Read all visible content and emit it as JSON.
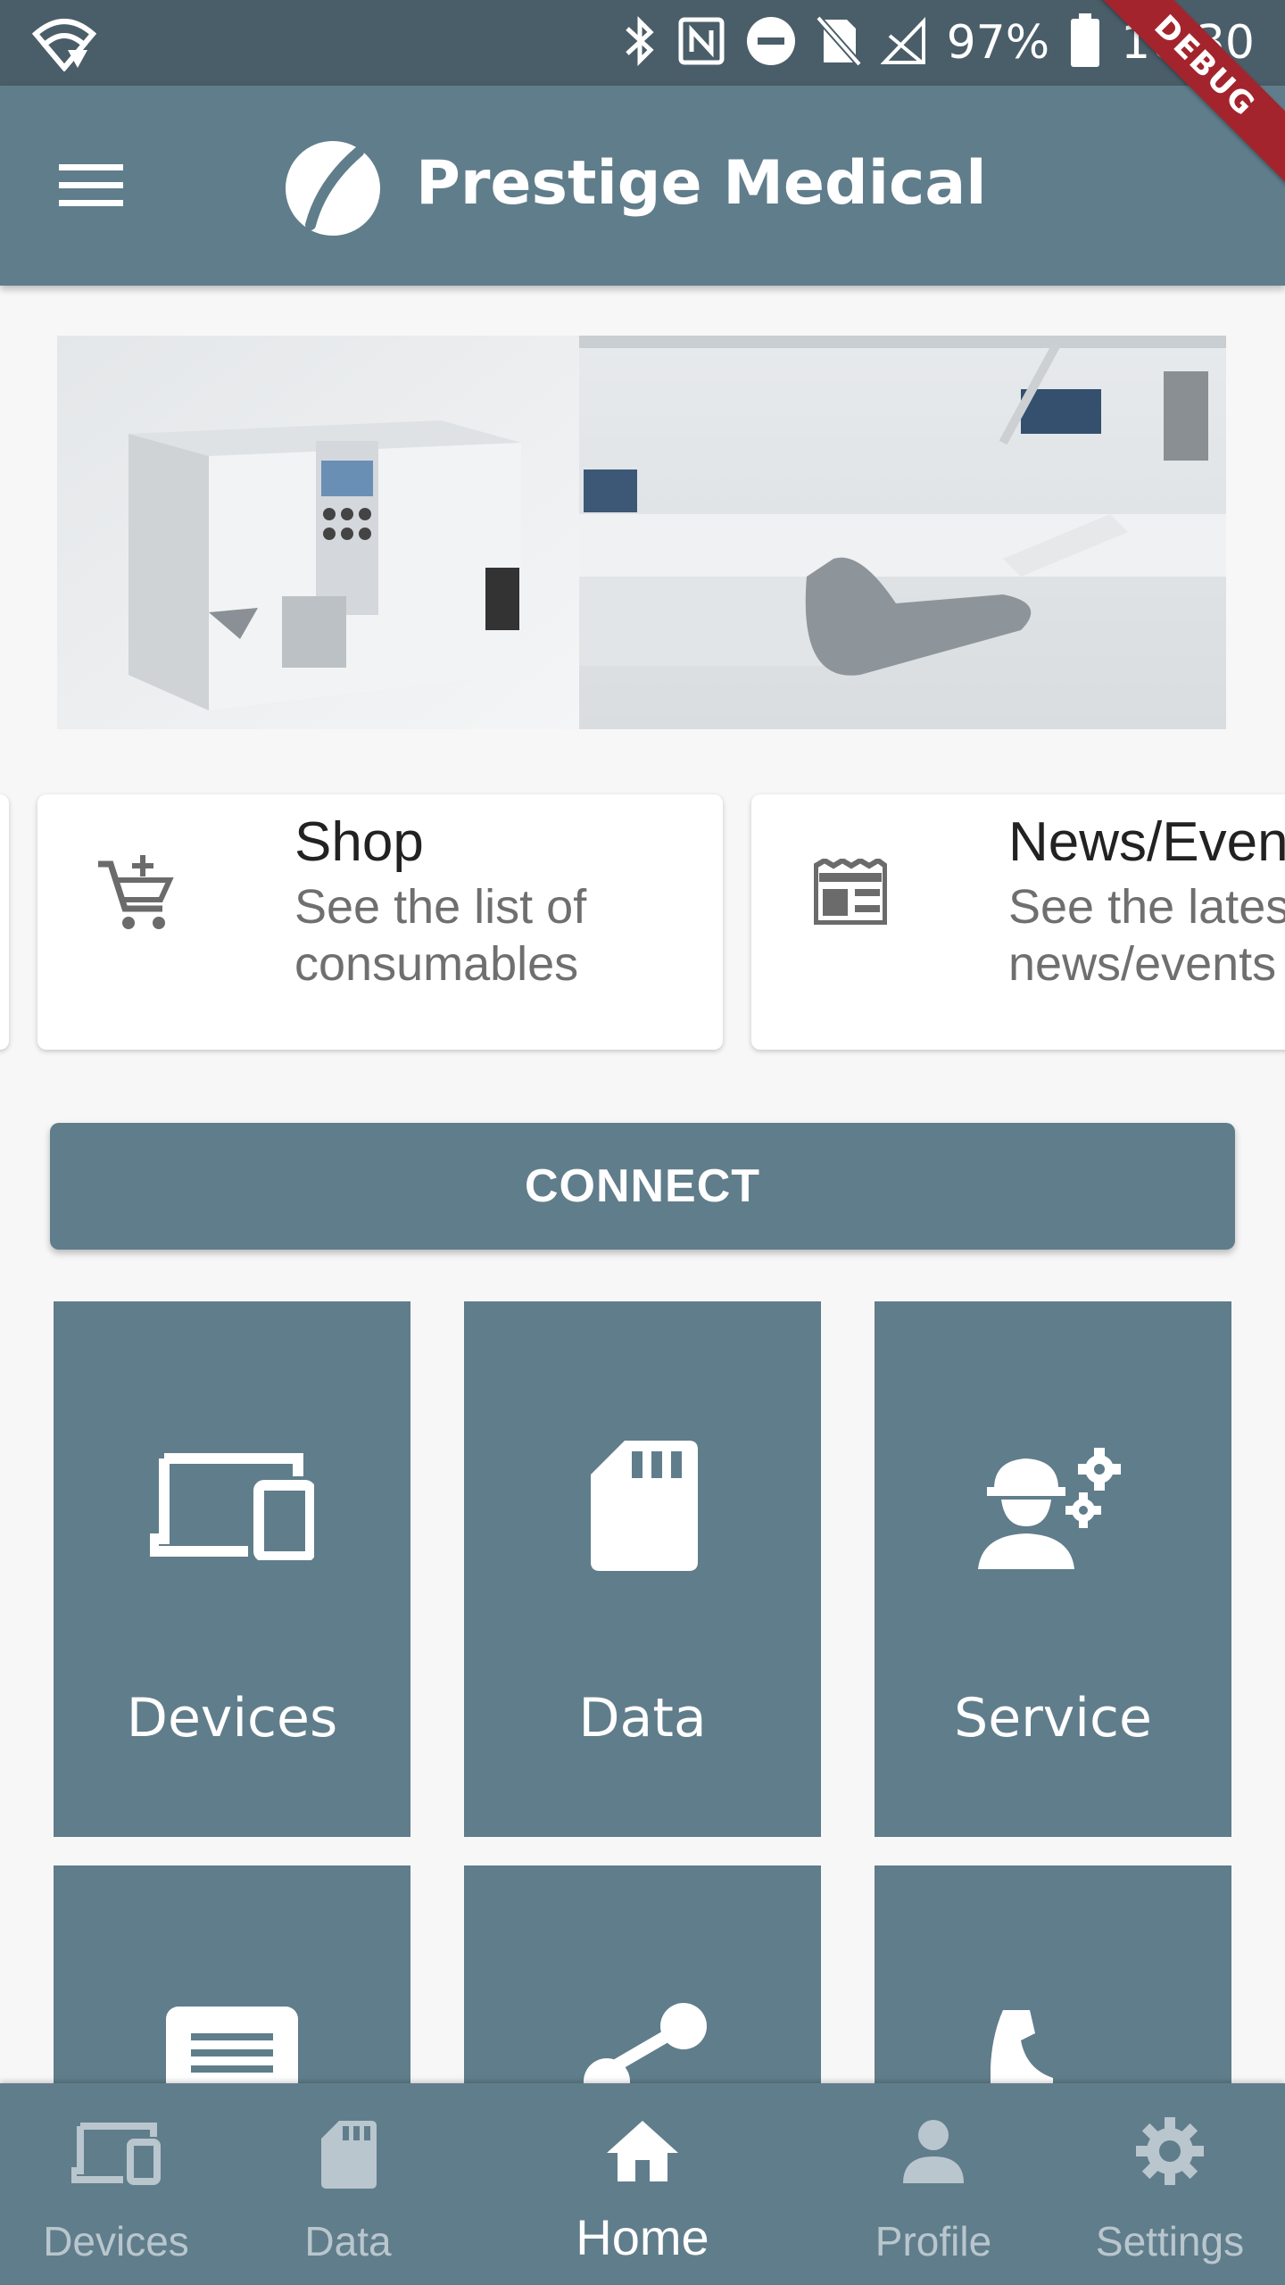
{
  "status_bar": {
    "battery": "97%",
    "time": "16:30"
  },
  "debug_banner": "DEBUG",
  "appbar": {
    "title": "Prestige Medical"
  },
  "cards": [
    {
      "title": "Shop",
      "subtitle_line1": "See the list of",
      "subtitle_line2": "consumables"
    },
    {
      "title": "News/Events",
      "subtitle_line1": "See the latest",
      "subtitle_line2": "news/events"
    }
  ],
  "connect_label": "CONNECT",
  "tiles": [
    {
      "label": "Devices"
    },
    {
      "label": "Data"
    },
    {
      "label": "Service"
    }
  ],
  "bottom_nav": [
    {
      "label": "Devices"
    },
    {
      "label": "Data"
    },
    {
      "label": "Home"
    },
    {
      "label": "Profile"
    },
    {
      "label": "Settings"
    }
  ],
  "colors": {
    "primary": "#607d8b",
    "status_bar": "#4a5e69",
    "debug": "#a3242d"
  }
}
